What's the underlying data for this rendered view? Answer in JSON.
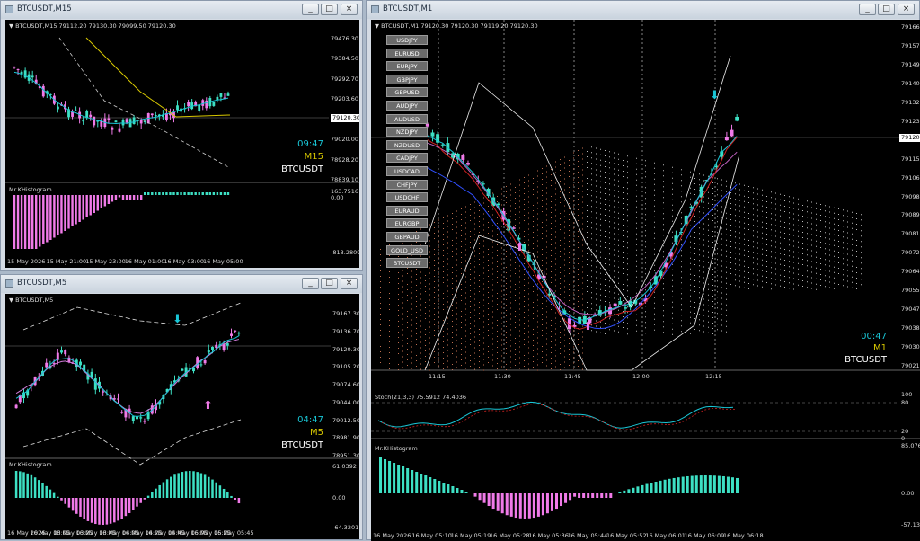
{
  "colors": {
    "bull": "#3de0c4",
    "bear": "#f07ae8",
    "ma_fast": "#ffffff",
    "cyan": "#19c6d6",
    "gold": "#d8c800",
    "white": "#ffffff"
  },
  "w15": {
    "title": "BTCUSDT,M15",
    "head": "▼ BTCUSDT,M15  79112.20 79130.30 79099.50 79120.30",
    "prices": [
      "79476.30",
      "79384.50",
      "79292.70",
      "79203.60",
      "79120.30",
      "79020.00",
      "78928.20",
      "78839.10"
    ],
    "time": "09:47",
    "tf": "M15",
    "sym": "BTCUSDT",
    "ind": "Mr.KHistogram",
    "ind_vals": [
      "163.7516",
      "0.00",
      "-813.2809"
    ],
    "times": [
      "15 May 2026",
      "15 May 21:00",
      "15 May 23:00",
      "16 May 01:00",
      "16 May 03:00",
      "16 May 05:00"
    ]
  },
  "w5": {
    "title": "BTCUSDT,M5",
    "head": "▼ BTCUSDT,M5",
    "prices": [
      "79167.30",
      "79136.70",
      "79120.30",
      "79105.20",
      "79074.60",
      "79044.00",
      "79012.50",
      "78981.90",
      "78951.30"
    ],
    "time": "04:47",
    "tf": "M5",
    "sym": "BTCUSDT",
    "ind": "Mr.KHistogram",
    "ind_vals": [
      "61.0392",
      "0.00",
      "-64.3201"
    ],
    "times": [
      "16 May 2026",
      "16 May 03:05",
      "16 May 03:25",
      "16 May 03:45",
      "16 May 04:05",
      "16 May 04:25",
      "16 May 04:45",
      "16 May 05:05",
      "16 May 05:25",
      "16 May 05:45"
    ]
  },
  "w1": {
    "title": "BTCUSDT,M1",
    "head": "▼ BTCUSDT,M1  79120.30 79120.30 79119.20 79120.30",
    "symbols": [
      "USDJPY",
      "EURUSD",
      "EURJPY",
      "GBPJPY",
      "GBPUSD",
      "AUDJPY",
      "AUDUSD",
      "NZDJPY",
      "NZDUSD",
      "CADJPY",
      "USDCAD",
      "CHFJPY",
      "USDCHF",
      "EURAUD",
      "EURGBP",
      "GBPAUD",
      "GOLD_USD",
      "BTCUSDT"
    ],
    "prices": [
      "79166.70",
      "79157.65",
      "79149.10",
      "79140.55",
      "79132.45",
      "79123.95",
      "79120.30",
      "79115.40",
      "79106.85",
      "79098.30",
      "79089.75",
      "79081.20",
      "79072.65",
      "79064.10",
      "79055.95",
      "79047.40",
      "79038.85",
      "79030.30",
      "79021.75"
    ],
    "hours": [
      "11:15",
      "11:30",
      "11:45",
      "12:00",
      "12:15"
    ],
    "time": "00:47",
    "tf": "M1",
    "sym": "BTCUSDT",
    "stoch": "Stoch(21,3,3) 75.5912 74.4036",
    "stoch_vals": [
      "100",
      "80",
      "20",
      "0"
    ],
    "ind": "Mr.KHistogram",
    "ind_vals": [
      "85.0769",
      "0.00",
      "-57.1371"
    ],
    "times": [
      "16 May 2026",
      "16 May 05:10",
      "16 May 05:19",
      "16 May 05:28",
      "16 May 05:36",
      "16 May 05:44",
      "16 May 05:52",
      "16 May 06:01",
      "16 May 06:09",
      "16 May 06:18"
    ]
  },
  "buttons": {
    "min": "_",
    "max": "□",
    "close": "×"
  }
}
